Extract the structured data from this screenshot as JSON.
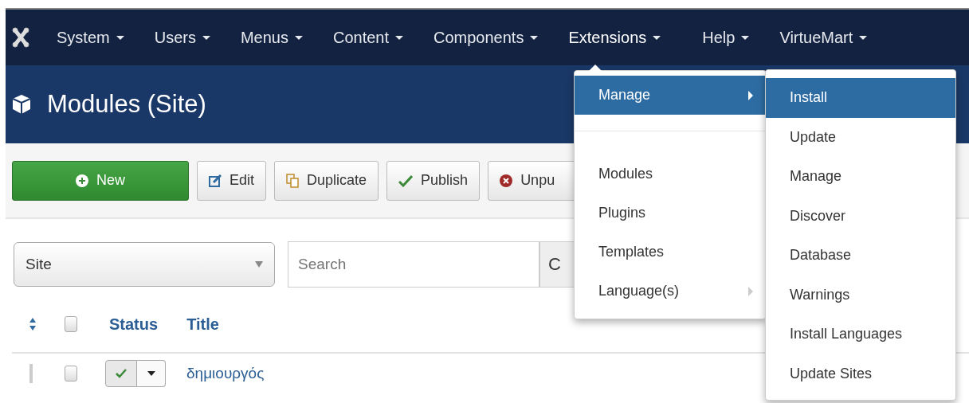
{
  "navbar": {
    "items": [
      {
        "label": "System",
        "selected": false
      },
      {
        "label": "Users",
        "selected": false
      },
      {
        "label": "Menus",
        "selected": false
      },
      {
        "label": "Content",
        "selected": false
      },
      {
        "label": "Components",
        "selected": false
      },
      {
        "label": "Extensions",
        "selected": true
      },
      {
        "label": "Help",
        "selected": false
      },
      {
        "label": "VirtueMart",
        "selected": false
      }
    ]
  },
  "header": {
    "title": "Modules (Site)"
  },
  "toolbar": [
    {
      "label": "New",
      "kind": "new"
    },
    {
      "label": "Edit",
      "kind": "edit"
    },
    {
      "label": "Duplicate",
      "kind": "duplicate"
    },
    {
      "label": "Publish",
      "kind": "publish"
    },
    {
      "label": "Unpu",
      "kind": "unpublish"
    }
  ],
  "filters": {
    "client": "Site",
    "search": {
      "placeholder": "Search"
    },
    "search_button": "C"
  },
  "table": {
    "columns": [
      "Status",
      "Title"
    ],
    "select_all_checked": false,
    "rows": [
      {
        "checked": false,
        "published": true,
        "title": "δημιουργός"
      }
    ]
  },
  "menu": {
    "items": [
      {
        "label": "Manage",
        "selected": true,
        "submenu": true,
        "kind": "item"
      },
      {
        "kind": "divider"
      },
      {
        "label": "Modules",
        "selected": false,
        "submenu": false,
        "kind": "item"
      },
      {
        "label": "Plugins",
        "selected": false,
        "submenu": false,
        "kind": "item"
      },
      {
        "label": "Templates",
        "selected": false,
        "submenu": false,
        "kind": "item"
      },
      {
        "label": "Language(s)",
        "selected": false,
        "submenu": true,
        "kind": "item"
      }
    ]
  },
  "submenu": {
    "items": [
      {
        "label": "Install",
        "selected": true
      },
      {
        "label": "Update",
        "selected": false
      },
      {
        "label": "Manage",
        "selected": false
      },
      {
        "label": "Discover",
        "selected": false
      },
      {
        "label": "Database",
        "selected": false
      },
      {
        "label": "Warnings",
        "selected": false
      },
      {
        "label": "Install Languages",
        "selected": false
      },
      {
        "label": "Update Sites",
        "selected": false
      }
    ]
  }
}
